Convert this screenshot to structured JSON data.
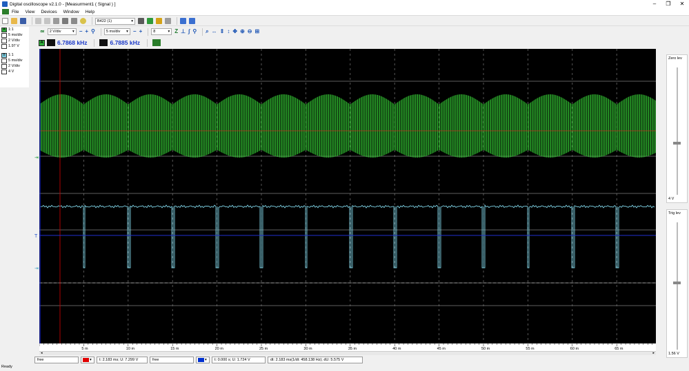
{
  "window": {
    "title": "Digital oscilloscope v2.1.0 - [Measurment1 ( Signal ) ]",
    "controls": [
      "–",
      "❐",
      "✕"
    ]
  },
  "menu": [
    "File",
    "View",
    "Devices",
    "Window",
    "Help"
  ],
  "toolbar": {
    "device": "B422 (1)",
    "ch_volts": "2 V/div",
    "timebase": "5 ms/div",
    "bits": "8"
  },
  "measure": {
    "ch_a_label": "A",
    "freq1": "6.7868 kHz",
    "freq2": "6.7885 kHz",
    "ch_b_label": "A"
  },
  "channels": {
    "a": {
      "id": "A",
      "probe": "1:1",
      "time": "5 ms/div",
      "volts": "2 V/div",
      "offset": "1.97 V"
    },
    "b": {
      "id": "B",
      "probe": "1:1",
      "time": "5 ms/div",
      "volts": "2 V/div",
      "offset": "4 V"
    }
  },
  "right_panel": {
    "zero_label": "Zero lev",
    "zero_value": "4 V",
    "trig_label": "Trig lev",
    "trig_value": "1.56 V"
  },
  "x_axis": {
    "ticks": [
      "5 m",
      "10 m",
      "15 m",
      "20 m",
      "25 m",
      "30 m",
      "35 m",
      "40 m",
      "45 m",
      "50 m",
      "55 m",
      "60 m",
      "65 m"
    ]
  },
  "status": {
    "cur1_mode": "free",
    "cur1_color": "#e00000",
    "cur1_text": "t: 2.183 ms;  U: 7.299 V",
    "cur2_mode": "free",
    "cur2_color": "#0030d0",
    "cur2_text": "t: 0.000 s;  U: 1.724 V",
    "delta_text": "dt: 2.183 ms(1/dt: 458.138 Hz);  dU: 5.575 V",
    "ready": "Ready"
  },
  "colors": {
    "channel_a": "#33c233",
    "channel_b": "#7fd3e6",
    "cursor_h": "#c00000",
    "cursor_b": "#2030d0",
    "screen_bg": "#000000",
    "grid": "#6a6a6a"
  }
}
